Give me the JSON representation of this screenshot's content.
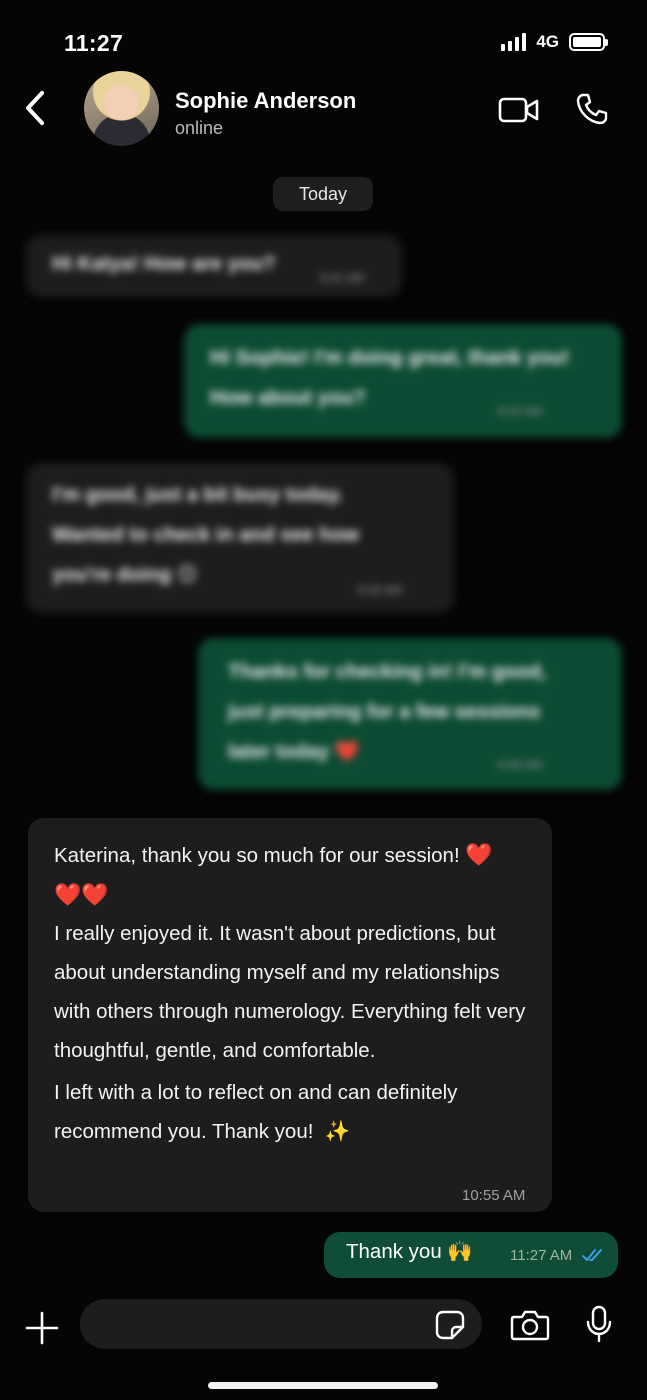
{
  "status_bar": {
    "time": "11:27",
    "network": "4G"
  },
  "header": {
    "contact_name": "Sophie Anderson",
    "contact_status": "online"
  },
  "chat": {
    "date_separator": "Today",
    "messages": [
      {
        "direction": "incoming",
        "blurred": true,
        "text": "Hi Katya! How are you?",
        "time": "9:41 AM"
      },
      {
        "direction": "outgoing",
        "blurred": true,
        "text": "Hi Sophie! I'm doing great, thank you!\nHow about you?",
        "time": "9:42 AM"
      },
      {
        "direction": "incoming",
        "blurred": true,
        "text": "I'm good, just a bit busy today.\nWanted to check in and see how\nyou're doing 😊",
        "time": "9:45 AM"
      },
      {
        "direction": "outgoing",
        "blurred": true,
        "text": "Thanks for checking in! I'm good,\njust preparing for a few sessions\nlater today ❤️",
        "time": "9:48 AM"
      },
      {
        "direction": "incoming",
        "blurred": false,
        "line1": "Katerina, thank you so much for our session!",
        "hearts": "❤️",
        "hearts_line2": "❤️❤️",
        "paragraph2": "I really enjoyed it. It wasn't about predictions, but about understanding myself and my relationships with others through numerology. Everything felt very thoughtful, gentle, and comfortable.",
        "paragraph3": "I left with a lot to reflect on and can definitely recommend you. Thank you!",
        "sparkle": "✨",
        "time": "10:55 AM"
      },
      {
        "direction": "outgoing",
        "blurred": false,
        "text": "Thank you 🙌",
        "time": "11:27 AM",
        "status": "read"
      }
    ]
  },
  "composer": {
    "placeholder": ""
  },
  "colors": {
    "incoming_bubble": "#1d1d1d",
    "outgoing_bubble": "#0c4b33",
    "read_ticks": "#3ea6ff",
    "background": "#050505"
  }
}
